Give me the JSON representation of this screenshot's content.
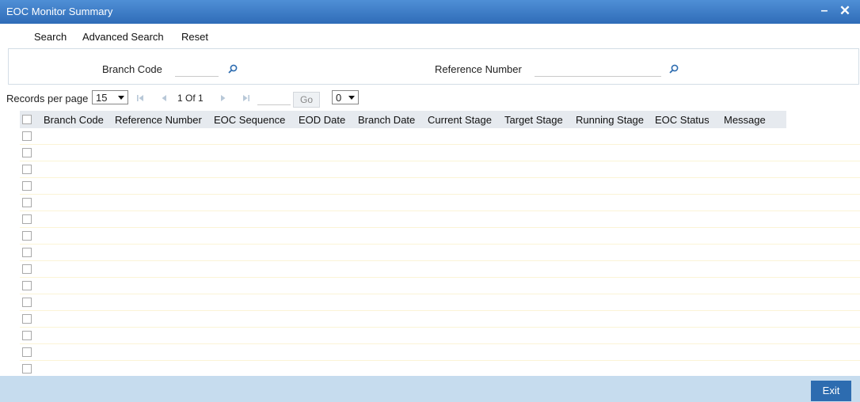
{
  "window": {
    "title": "EOC Monitor Summary",
    "minimize_icon": "minimize-icon",
    "close_icon": "close-icon"
  },
  "menu": {
    "items": [
      "Search",
      "Advanced Search",
      "Reset"
    ]
  },
  "criteria": {
    "branch_code_label": "Branch Code",
    "branch_code_value": "",
    "reference_number_label": "Reference Number",
    "reference_number_value": "",
    "lookup_icon": "search-icon"
  },
  "pager": {
    "records_per_page_label": "Records per page",
    "records_per_page_value": "15",
    "page_text": "1 Of 1",
    "go_value": "",
    "go_label": "Go",
    "page_select_value": "0"
  },
  "grid": {
    "columns": [
      "Branch Code",
      "Reference Number",
      "EOC Sequence",
      "EOD Date",
      "Branch Date",
      "Current Stage",
      "Target Stage",
      "Running Stage",
      "EOC Status",
      "Message"
    ],
    "empty_rows": 15
  },
  "footer": {
    "exit_label": "Exit"
  },
  "colors": {
    "title_bar": "#3a7bc8",
    "footer": "#c6dcee",
    "exit_button": "#2d6cb0"
  }
}
